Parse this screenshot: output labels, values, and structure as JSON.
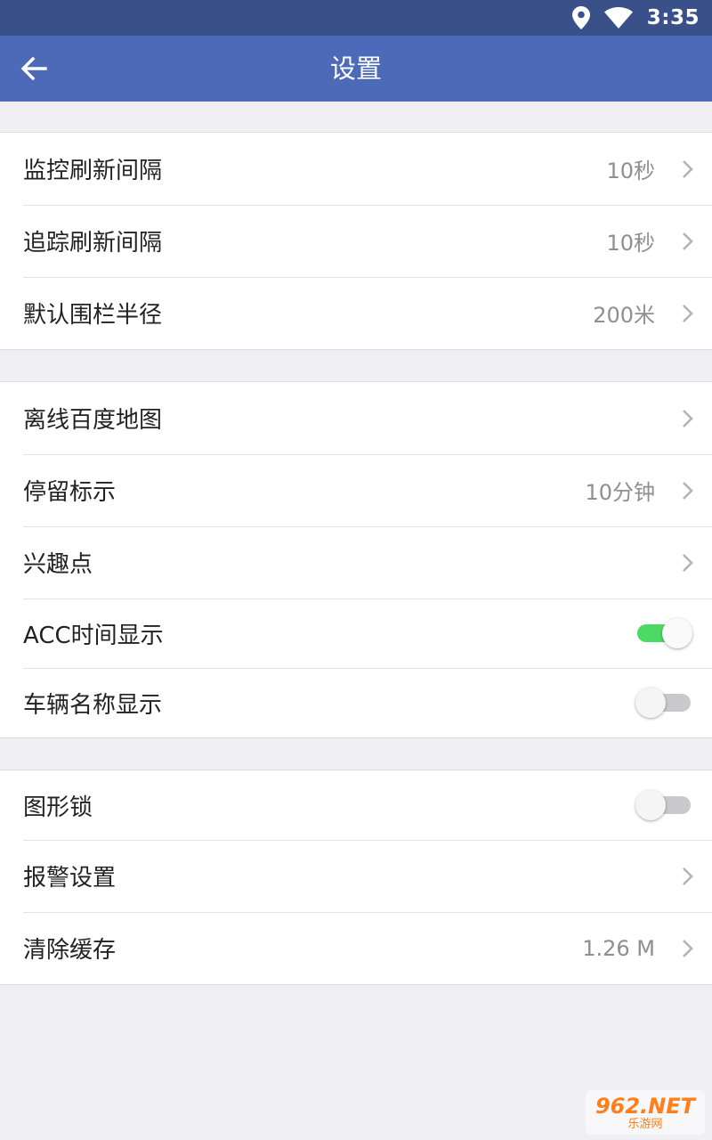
{
  "status_bar": {
    "time": "3:35",
    "icons": [
      "location-icon",
      "wifi-icon"
    ]
  },
  "app_bar": {
    "title": "设置",
    "back_icon": "arrow-left-icon"
  },
  "groups": [
    {
      "items": [
        {
          "label": "监控刷新间隔",
          "value": "10秒",
          "control": "chevron"
        },
        {
          "label": "追踪刷新间隔",
          "value": "10秒",
          "control": "chevron"
        },
        {
          "label": "默认围栏半径",
          "value": "200米",
          "control": "chevron"
        }
      ]
    },
    {
      "items": [
        {
          "label": "离线百度地图",
          "value": "",
          "control": "chevron"
        },
        {
          "label": "停留标示",
          "value": "10分钟",
          "control": "chevron"
        },
        {
          "label": "兴趣点",
          "value": "",
          "control": "chevron"
        },
        {
          "label": "ACC时间显示",
          "control": "toggle",
          "on": true
        },
        {
          "label": "车辆名称显示",
          "control": "toggle",
          "on": false
        }
      ]
    },
    {
      "items": [
        {
          "label": "图形锁",
          "control": "toggle",
          "on": false
        },
        {
          "label": "报警设置",
          "value": "",
          "control": "chevron"
        },
        {
          "label": "清除缓存",
          "value": "1.26 M",
          "control": "chevron"
        }
      ]
    }
  ],
  "watermark": {
    "main": "962.NET",
    "sub": "乐游网"
  },
  "colors": {
    "status_bar": "#3a5089",
    "app_bar": "#4c6ab8",
    "toggle_on": "#4cd964",
    "toggle_off": "#c9c9cc",
    "background": "#efeff4"
  }
}
